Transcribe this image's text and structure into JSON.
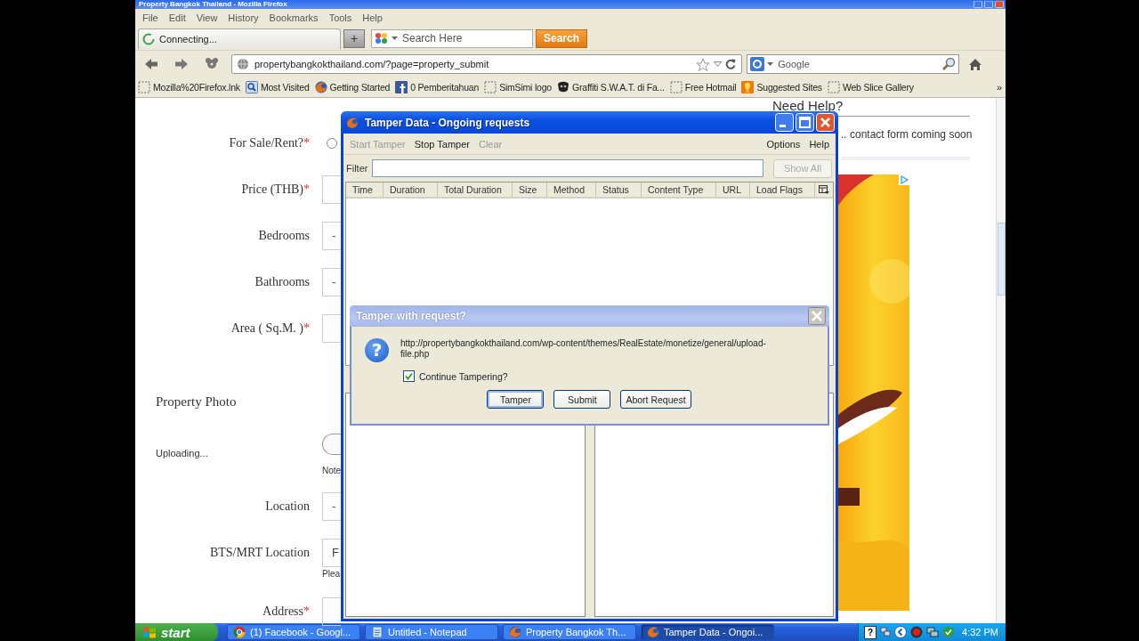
{
  "browser": {
    "title": "Property Bangkok Thailand - Mozilla Firefox",
    "menu": [
      "File",
      "Edit",
      "View",
      "History",
      "Bookmarks",
      "Tools",
      "Help"
    ],
    "tab": {
      "label": "Connecting..."
    },
    "new_tab": "+",
    "search": {
      "placeholder": "Search Here",
      "button": "Search"
    },
    "address": "propertybangkokthailand.com/?page=property_submit",
    "web_search": {
      "placeholder": "Google"
    },
    "bookmarks": [
      {
        "kind": "page",
        "label": "Mozilla%20Firefox.lnk"
      },
      {
        "kind": "folder",
        "label": "Most Visited"
      },
      {
        "kind": "globe",
        "label": "Getting Started"
      },
      {
        "kind": "tile",
        "label": "0 Pemberitahuan"
      },
      {
        "kind": "page",
        "label": "SimSimi logo"
      },
      {
        "kind": "mask",
        "label": "Graffiti S.W.A.T. di Fa..."
      },
      {
        "kind": "page",
        "label": "Free Hotmail"
      },
      {
        "kind": "bulb",
        "label": "Suggested Sites"
      },
      {
        "kind": "page",
        "label": "Web Slice Gallery"
      }
    ],
    "bookmarks_more": "»"
  },
  "page": {
    "form": [
      {
        "kind": "radio",
        "label": "For Sale/Rent?",
        "mark": "*",
        "checked": false
      },
      {
        "kind": "text",
        "label": "Price (THB)",
        "mark": "*"
      },
      {
        "kind": "select",
        "label": "Bedrooms",
        "value": "-"
      },
      {
        "kind": "select",
        "label": "Bathrooms",
        "value": "-"
      },
      {
        "kind": "text",
        "label": "Area ( Sq.M. )",
        "mark": "*"
      },
      {
        "kind": "heading",
        "label": "Property Photo"
      },
      {
        "kind": "upload",
        "label": "Uploading...",
        "note": "Note"
      },
      {
        "kind": "select",
        "label": "Location",
        "value": "-"
      },
      {
        "kind": "text",
        "label": "BTS/MRT Location",
        "value": "F",
        "note": "Plea"
      },
      {
        "kind": "text",
        "label": "Address",
        "mark": "*"
      }
    ],
    "help": {
      "heading": "Need Help?",
      "text": ".. contact form coming soon"
    }
  },
  "tamper_window": {
    "title": "Tamper Data - Ongoing requests",
    "menu_left": [
      {
        "label": "Start Tamper",
        "disabled": true
      },
      {
        "label": "Stop Tamper",
        "disabled": false
      },
      {
        "label": "Clear",
        "disabled": true
      }
    ],
    "menu_right": [
      {
        "label": "Options",
        "disabled": false
      },
      {
        "label": "Help",
        "disabled": false
      }
    ],
    "filter": {
      "label": "Filter",
      "button": "Show All",
      "button_disabled": true
    },
    "columns": [
      "Time",
      "Duration",
      "Total Duration",
      "Size",
      "Method",
      "Status",
      "Content Type",
      "URL",
      "Load Flags"
    ]
  },
  "dialog": {
    "title": "Tamper with request?",
    "icon_glyph": "?",
    "url": "http://propertybangkokthailand.com/wp-content/themes/RealEstate/monetize/general/upload-file.php",
    "checkbox": {
      "label": "Continue Tampering?",
      "checked": true
    },
    "buttons": [
      {
        "label": "Tamper",
        "default": true
      },
      {
        "label": "Submit",
        "default": false
      },
      {
        "label": "Abort Request",
        "default": false
      }
    ]
  },
  "taskbar": {
    "start": "start",
    "tasks": [
      {
        "kind": "chrome",
        "label": "(1) Facebook - Googl...",
        "selected": false
      },
      {
        "kind": "notepad",
        "label": "Untitled - Notepad",
        "selected": false
      },
      {
        "kind": "globe",
        "label": "Property Bangkok Th...",
        "selected": false
      },
      {
        "kind": "globe",
        "label": "Tamper Data - Ongoi...",
        "selected": true
      }
    ],
    "tray_glyph": "?",
    "clock": "4:32 PM"
  }
}
